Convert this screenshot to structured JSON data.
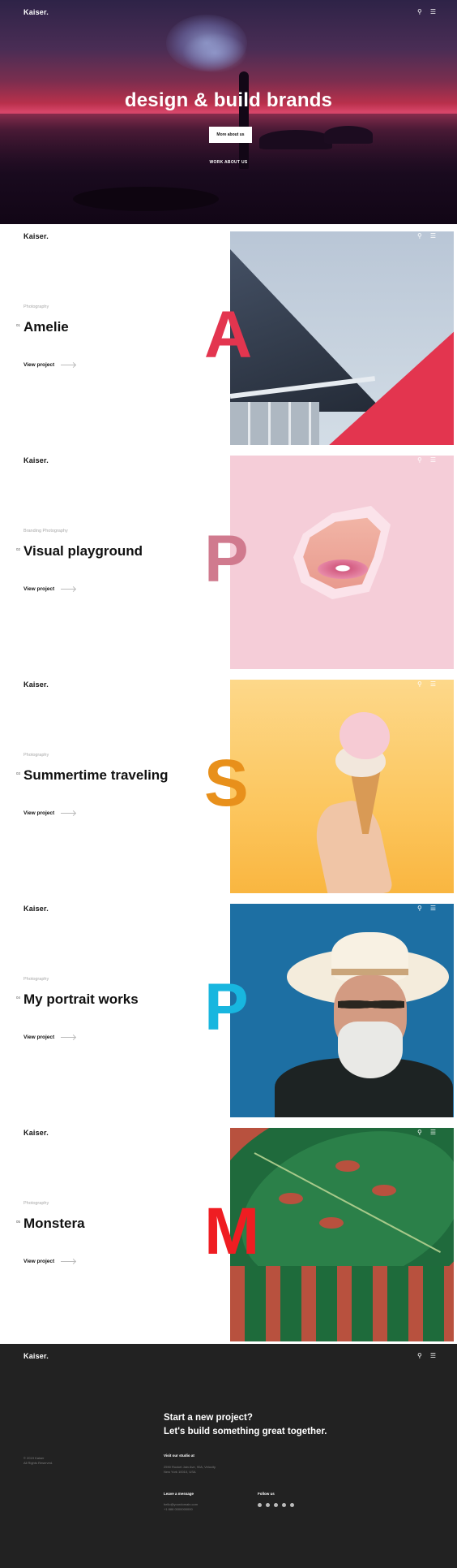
{
  "brand": {
    "logo": "Kaiser."
  },
  "header_icons": {
    "search": "search-icon",
    "menu": "menu-icon"
  },
  "hero": {
    "title": "design & build brands",
    "button_label": "More about us",
    "secondary_link": "WORK ABOUT US"
  },
  "projects": [
    {
      "category": "Photography",
      "number": "01",
      "title": "Amelie",
      "link": "View project",
      "letter": "A",
      "letter_color": "#e3354f"
    },
    {
      "category": "Branding Photography",
      "number": "02",
      "title": "Visual playground",
      "link": "View project",
      "letter": "P",
      "letter_color": "#d07a8e"
    },
    {
      "category": "Photography",
      "number": "03",
      "title": "Summertime traveling",
      "link": "View project",
      "letter": "S",
      "letter_color": "#e8901b"
    },
    {
      "category": "Photography",
      "number": "04",
      "title": "My portrait works",
      "link": "View project",
      "letter": "P",
      "letter_color": "#18b6df"
    },
    {
      "category": "Photography",
      "number": "05",
      "title": "Monstera",
      "link": "View project",
      "letter": "M",
      "letter_color": "#ef1d22"
    }
  ],
  "footer": {
    "heading_line1": "Start a new project?",
    "heading_line2": "Let's build something great together.",
    "copyright_line1": "© 2019 Kaiser",
    "copyright_line2": "All Rights Reserved.",
    "studio_heading": "Visit our studio at",
    "studio_line1": "2590 Rocket Jain Ave, 90A, Velocity",
    "studio_line2": "New York 10010, USA",
    "message_heading": "Leave a message",
    "message_email": "hello@yourdomain.com",
    "message_phone": "+1 888 0000000000",
    "follow_heading": "Follow us",
    "social": [
      "facebook-icon",
      "twitter-icon",
      "instagram-icon",
      "dribbble-icon",
      "pinterest-icon"
    ]
  }
}
